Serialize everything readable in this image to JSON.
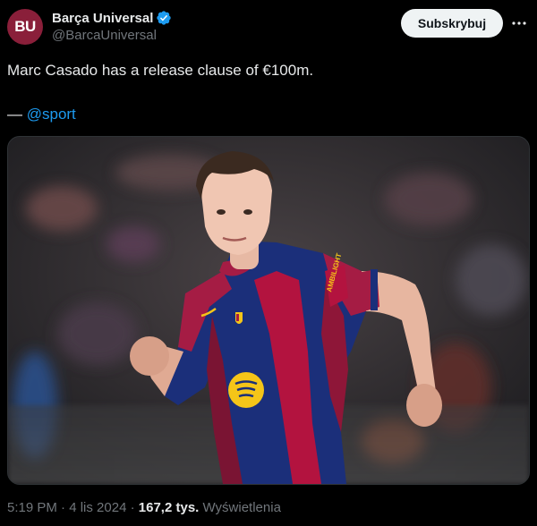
{
  "author": {
    "avatar_text": "BU",
    "display_name": "Barça Universal",
    "handle": "@BarcaUniversal",
    "verified_icon": "verified-badge-icon"
  },
  "actions": {
    "subscribe_label": "Subskrybuj",
    "more_icon": "more-horizontal-icon"
  },
  "tweet": {
    "text": "Marc Casado has a release clause of €100m.",
    "attribution_prefix": "— ",
    "mention": "@sport"
  },
  "media": {
    "type": "photo",
    "jersey_sponsor_text": "AMBILIGHT"
  },
  "meta": {
    "time": "5:19 PM",
    "separator": "·",
    "date": "4 lis 2024",
    "views_count": "167,2 tys.",
    "views_label": "Wyświetlenia"
  },
  "colors": {
    "background": "#000000",
    "text_primary": "#e7e9ea",
    "text_secondary": "#71767b",
    "link": "#1d9bf0",
    "verified": "#1d9bf0",
    "button_bg": "#eff3f4",
    "avatar_bg": "#8a1f3a"
  }
}
